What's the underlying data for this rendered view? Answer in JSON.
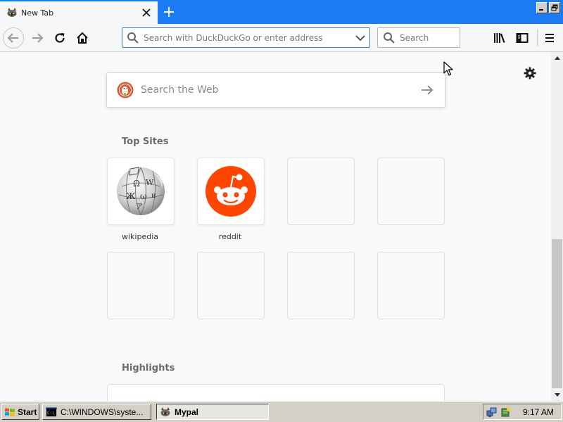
{
  "window": {
    "tab_title": "New Tab",
    "tab_favicon": "mypal-raccoon-icon",
    "controls": [
      "minimize-icon",
      "restore-icon"
    ]
  },
  "navbar": {
    "url_placeholder": "Search with DuckDuckGo or enter address",
    "url_value": "",
    "search_placeholder": "Search",
    "icons": [
      "back-icon",
      "forward-icon",
      "reload-icon",
      "home-icon",
      "library-icon",
      "sidebar-icon",
      "menu-icon"
    ]
  },
  "newtab": {
    "websearch_placeholder": "Search the Web",
    "top_sites_title": "Top Sites",
    "highlights_title": "Highlights",
    "top_sites": [
      {
        "label": "wikipedia",
        "icon": "wikipedia-globe-icon"
      },
      {
        "label": "reddit",
        "icon": "reddit-alien-icon"
      },
      {
        "label": ""
      },
      {
        "label": ""
      },
      {
        "label": ""
      },
      {
        "label": ""
      },
      {
        "label": ""
      },
      {
        "label": ""
      }
    ]
  },
  "taskbar": {
    "start_label": "Start",
    "tasks": [
      {
        "label": "C:\\WINDOWS\\syste...",
        "icon": "cmd-icon",
        "active": false
      },
      {
        "label": "Mypal",
        "icon": "mypal-raccoon-icon",
        "active": true
      }
    ],
    "clock": "9:17 AM"
  },
  "colors": {
    "accent": "#0a84ff",
    "titlebar": "#1c7cf3",
    "reddit": "#ff4500",
    "duckduckgo": "#de5833"
  }
}
